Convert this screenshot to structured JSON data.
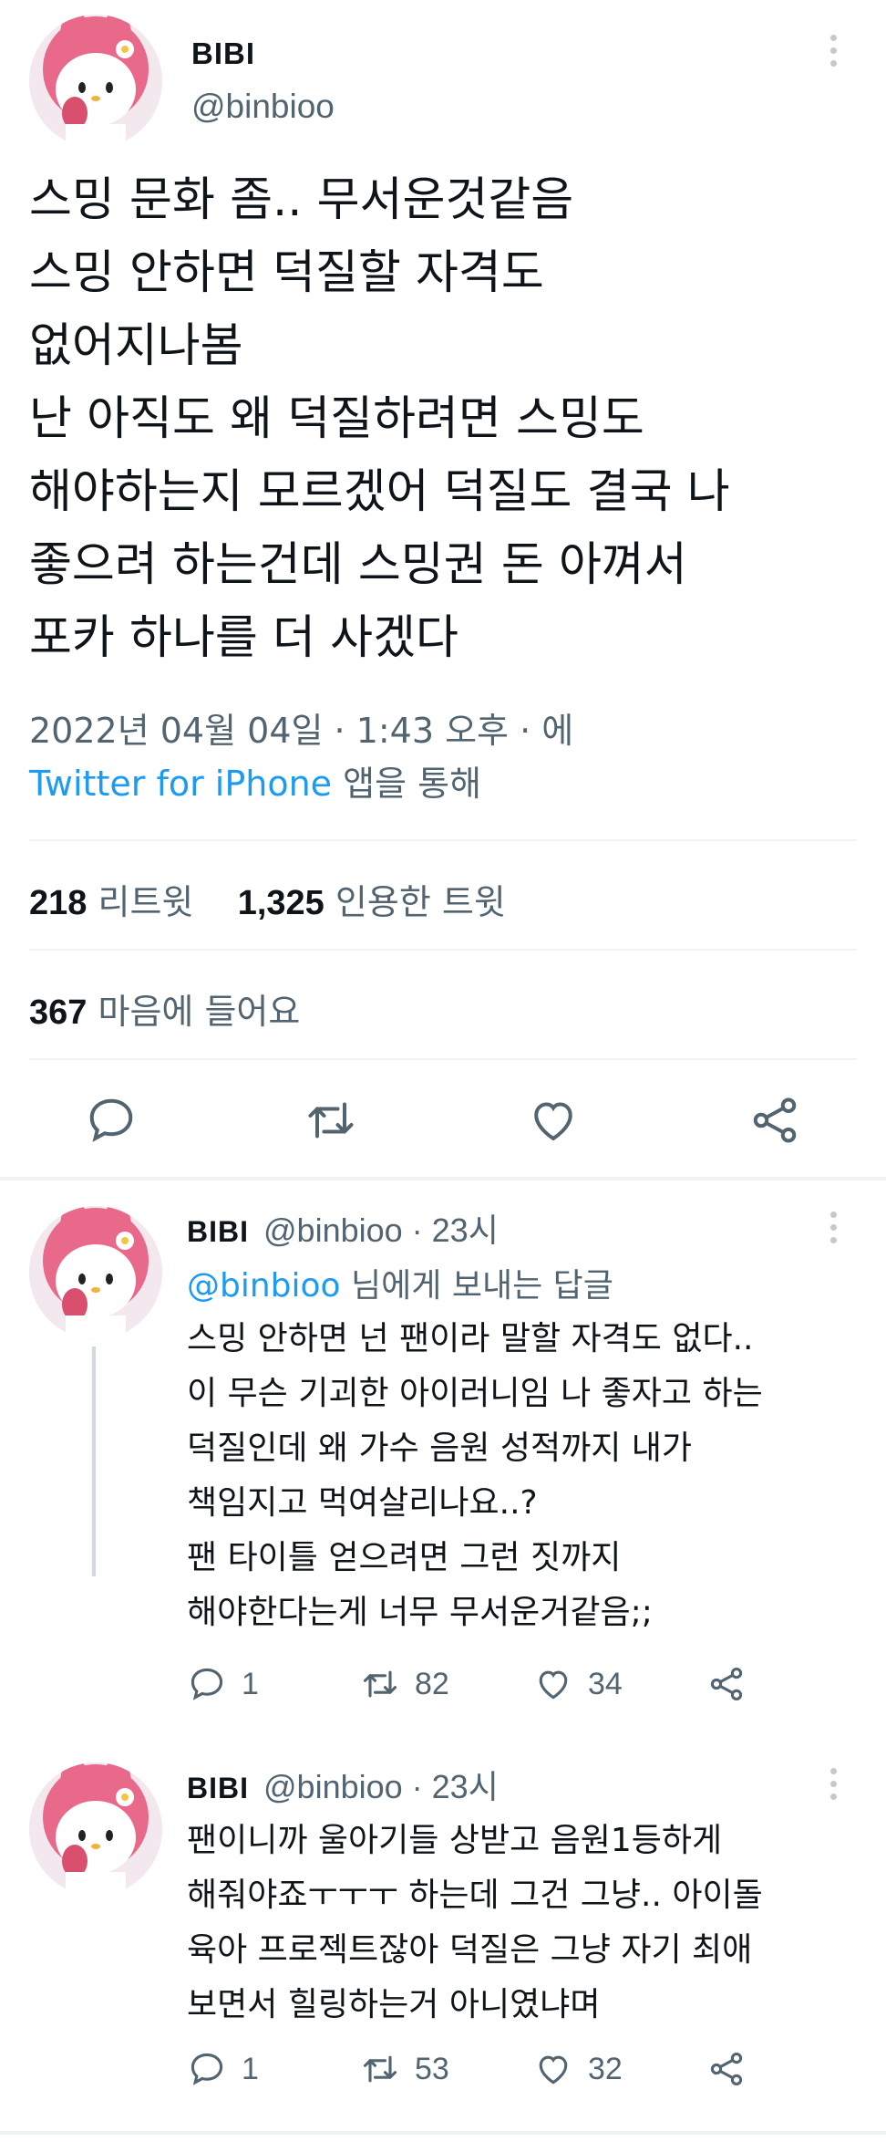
{
  "main_tweet": {
    "name": "BIBI",
    "handle": "@binbioo",
    "text_lines": [
      "스밍 문화 좀.. 무서운것같음",
      "스밍 안하면 덕질할 자격도",
      "없어지나봄",
      "난 아직도 왜 덕질하려면 스밍도",
      "해야하는지 모르겠어 덕질도 결국 나",
      "좋으려 하는건데 스밍권 돈 아껴서",
      "포카 하나를 더 사겠다"
    ],
    "timestamp": "2022년 04월 04일 · 1:43 오후 · 에",
    "source": "Twitter for iPhone",
    "source_suffix": " 앱을 통해",
    "retweets": "218",
    "retweets_label": "리트윗",
    "quotes": "1,325",
    "quotes_label": "인용한 트윗",
    "likes": "367",
    "likes_label": "마음에 들어요",
    "icons": [
      "reply-icon",
      "retweet-icon",
      "like-icon",
      "share-icon"
    ]
  },
  "replies": [
    {
      "name": "BIBI",
      "handle_time": "@binbioo · 23시",
      "reply_to_mention": "@binbioo",
      "reply_to_suffix": " 님에게 보내는 답글",
      "text_lines": [
        "스밍 안하면 넌 팬이라 말할 자격도 없다..",
        "이 무슨 기괴한 아이러니임 나 좋자고 하는",
        "덕질인데 왜 가수 음원 성적까지 내가",
        "책임지고 먹여살리나요..?",
        "팬 타이틀 얻으려면 그런 짓까지",
        "해야한다는게 너무 무서운거같음;;"
      ],
      "reply_count": "1",
      "retweet_count": "82",
      "like_count": "34"
    },
    {
      "name": "BIBI",
      "handle_time": "@binbioo · 23시",
      "text_lines": [
        "팬이니까 울아기들 상받고 음원1등하게",
        "해줘야죠ㅜㅜㅜ 하는데 그건 그냥.. 아이돌",
        "육아 프로젝트잖아 덕질은 그냥 자기 최애",
        "보면서 힐링하는거 아니였냐며"
      ],
      "reply_count": "1",
      "retweet_count": "53",
      "like_count": "32"
    }
  ],
  "colors": {
    "accent": "#1d9bf0",
    "secondary_text": "#536471",
    "avatar_pink": "#e8698a"
  }
}
